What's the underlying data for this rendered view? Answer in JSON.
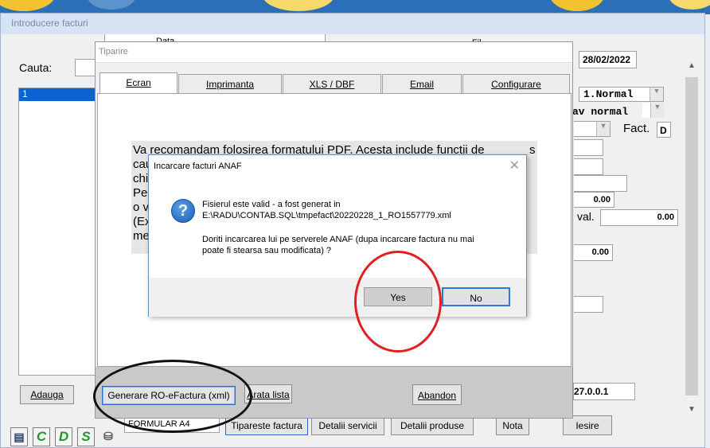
{
  "main": {
    "title": "Introducere facturi",
    "cauta_label": "Cauta:",
    "col_data": "Data",
    "col_fil": "Fil",
    "list_first": "1",
    "date": "28/02/2022",
    "combo1": "1.Normal",
    "combo2": "av normal",
    "fact_label": "Fact.",
    "fact_value": "D",
    "val_label": "val.",
    "amount1": "0.00",
    "amount2": "0.00",
    "amount3": "0.00",
    "version": "27.0.0.1",
    "add_button": "Adauga",
    "arata_button": "Arata lista",
    "abandon_button": "Abandon",
    "formular": "FORMULAR A4",
    "tipareste": "Tipareste factura",
    "detalii_servicii": "Detalii servicii",
    "detalii_produse": "Detalii produse",
    "nota": "Nota",
    "iesire": "Iesire",
    "icons": [
      "id-card-icon",
      "c-icon",
      "d-icon",
      "s-icon",
      "stamp-icon"
    ],
    "icon_letters": [
      "C",
      "D",
      "S"
    ]
  },
  "tiparire": {
    "title": "Tiparire",
    "tabs": [
      "Ecran",
      "Imprimanta",
      "XLS / DBF",
      "Email",
      "Configurare"
    ],
    "info_lines": [
      "Va recomandam folosirea formatului  PDF. Acesta include functii de",
      "cau",
      "chia",
      "",
      "Per",
      "o ve",
      "(Ex",
      "mer"
    ],
    "info_right": "s",
    "generate_button": "Generare RO-eFactura (xml)"
  },
  "dialog": {
    "title": "Incarcare facturi ANAF",
    "close": "✕",
    "line1": "Fisierul este valid - a fost generat in",
    "line2": "E:\\RADU\\CONTAB.SQL\\tmpefact\\20220228_1_RO1557779.xml",
    "line3": "Doriti incarcarea lui pe serverele ANAF (dupa incarcare factura nu mai",
    "line4": "poate fi stearsa sau modificata) ?",
    "yes": "Yes",
    "no": "No"
  }
}
